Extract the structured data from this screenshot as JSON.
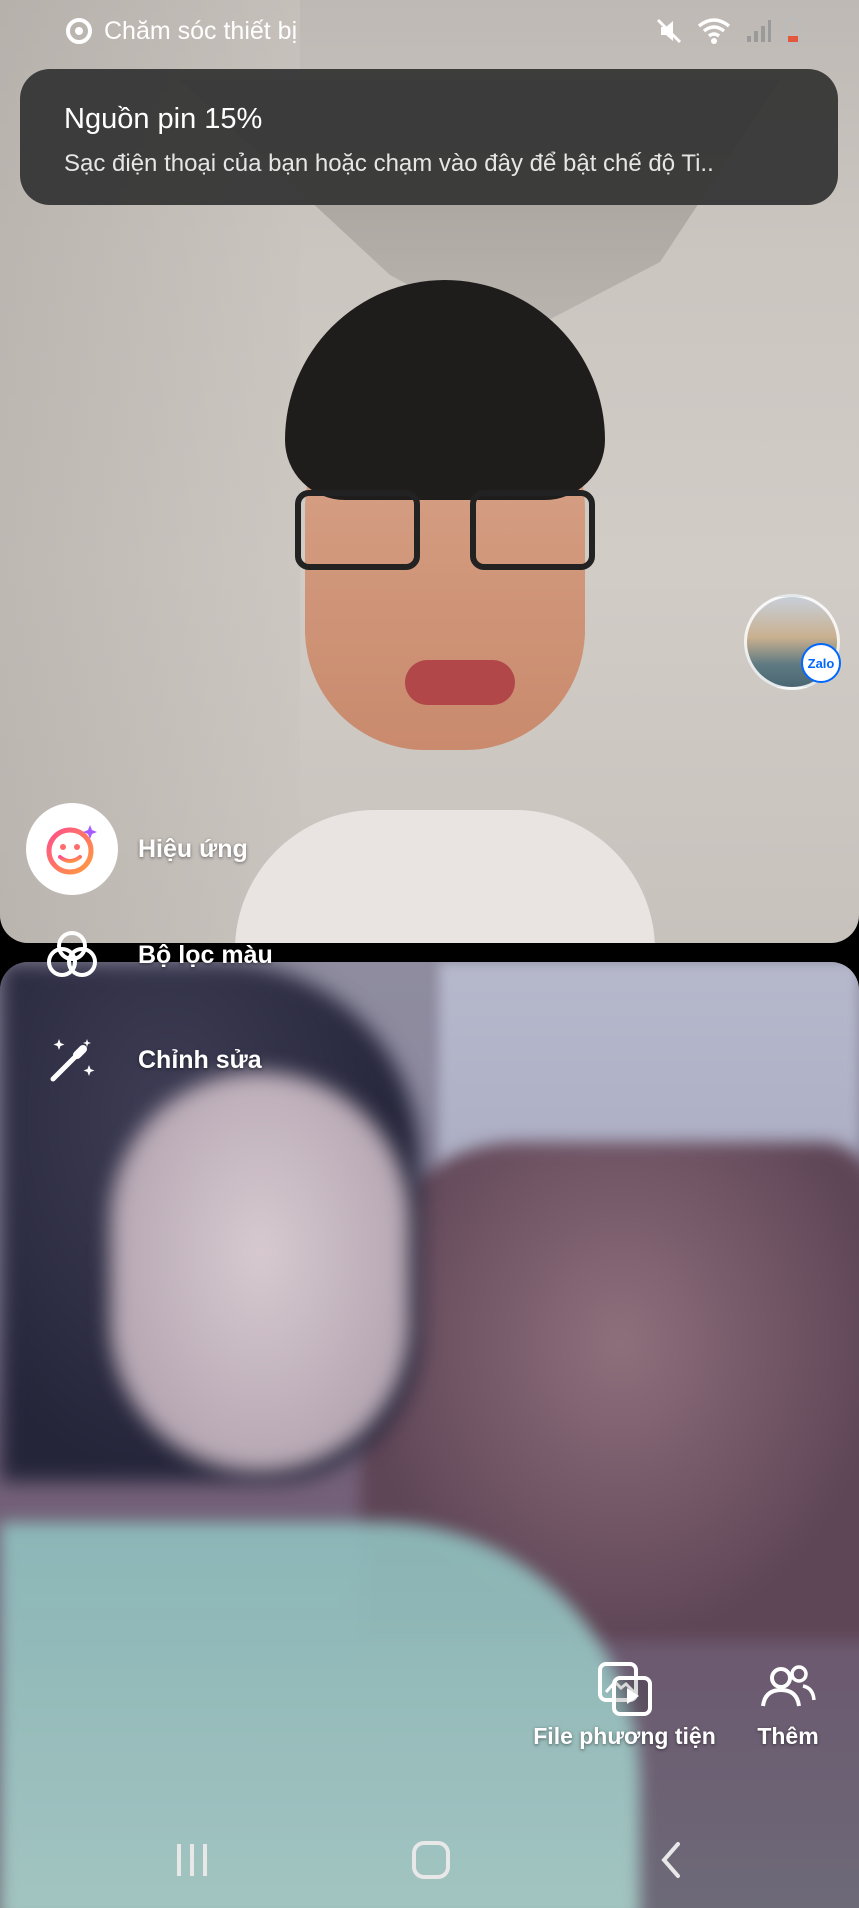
{
  "status_bar": {
    "app_label": "Chăm sóc thiết bị",
    "icons": [
      "device-care-icon",
      "mute-icon",
      "wifi-icon",
      "signal-icon",
      "battery-icon"
    ],
    "battery_color": "#e3573d"
  },
  "notification": {
    "title": "Nguồn pin 15%",
    "body": "Sạc điện thoại của bạn hoặc chạm vào đây để bật chế độ Ti.."
  },
  "floating_avatar": {
    "badge": "Zalo",
    "badge_color": "#0068ff"
  },
  "effects_menu": {
    "items": [
      {
        "label": "Hiệu ứng",
        "icon": "smiley-sparkle-icon"
      },
      {
        "label": "Bộ lọc màu",
        "icon": "color-filter-icon"
      },
      {
        "label": "Chỉnh sửa",
        "icon": "magic-wand-icon"
      }
    ],
    "effects_gradient": [
      "#ff4f8b",
      "#ff9b3d"
    ]
  },
  "actions": {
    "media_label": "File phương tiện",
    "more_label": "Thêm"
  },
  "nav_bar": {
    "buttons": [
      "recent-apps-icon",
      "home-icon",
      "back-icon"
    ]
  }
}
